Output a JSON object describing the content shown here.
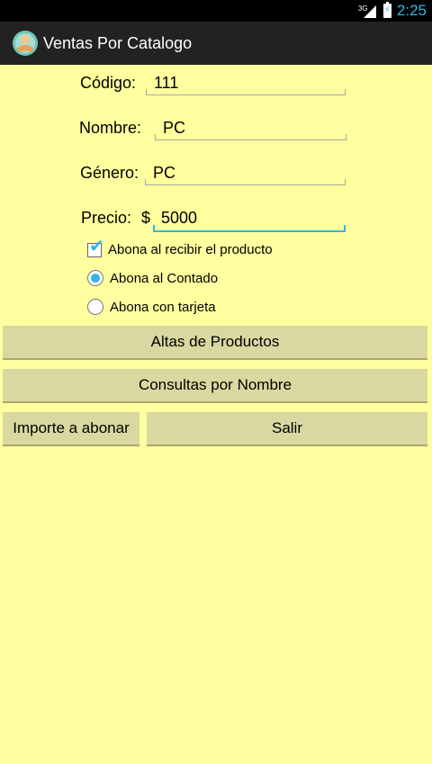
{
  "status_bar": {
    "network_type": "3G",
    "time": "2:25"
  },
  "action_bar": {
    "title": "Ventas Por Catalogo",
    "icon": "app-icon"
  },
  "form": {
    "codigo": {
      "label": "Código:",
      "value": "111"
    },
    "nombre": {
      "label": "Nombre:",
      "value": "PC"
    },
    "genero": {
      "label": "Género:",
      "value": "PC"
    },
    "precio": {
      "label": "Precio:",
      "currency": "$",
      "value": "5000"
    }
  },
  "options": {
    "abona_recibir": {
      "label": "Abona al recibir el producto",
      "checked": true
    },
    "abona_contado": {
      "label": "Abona al Contado",
      "selected": true
    },
    "abona_tarjeta": {
      "label": "Abona con tarjeta",
      "selected": false
    }
  },
  "buttons": {
    "altas": "Altas de Productos",
    "consultas": "Consultas por Nombre",
    "importe": "Importe a abonar",
    "salir": "Salir"
  },
  "colors": {
    "background": "#ffff9f",
    "accent": "#33b5e5",
    "button": "#d9d8a0",
    "actionbar": "#222222"
  }
}
